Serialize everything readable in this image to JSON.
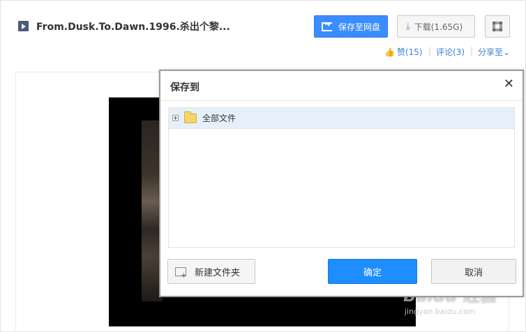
{
  "header": {
    "file_icon": "video-file-icon",
    "file_title": "From.Dusk.To.Dawn.1996.杀出个黎...",
    "save_to_cloud_label": "保存至网盘",
    "download_label": "下载(1.65G)",
    "qr_icon": "qr-code-icon"
  },
  "social": {
    "like_label": "赞(15)",
    "comment_label": "评论(3)",
    "share_label": "分享至",
    "share_chevron": "⌄"
  },
  "watermark": {
    "brand": "Baidu 经验",
    "url": "jingyan.baidu.com"
  },
  "dialog": {
    "title": "保存到",
    "close_glyph": "✕",
    "tree": [
      {
        "label": "全部文件",
        "icon": "folder-icon",
        "expander": "plus"
      }
    ],
    "new_folder_label": "新建文件夹",
    "confirm_label": "确定",
    "cancel_label": "取消"
  },
  "colors": {
    "primary_blue": "#1e8dff",
    "link_blue": "#3b7fd4",
    "selected_row": "#e6f0fb"
  }
}
